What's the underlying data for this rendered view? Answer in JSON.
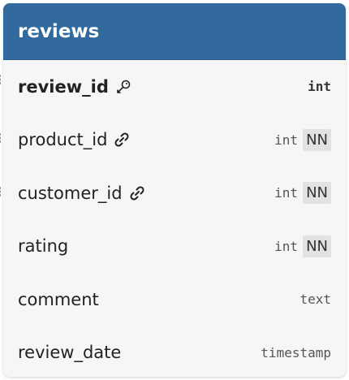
{
  "table": {
    "name": "reviews",
    "columns": [
      {
        "name": "review_id",
        "type": "int",
        "primary_key": true,
        "foreign_key": false,
        "not_null": false,
        "icon": "key-icon"
      },
      {
        "name": "product_id",
        "type": "int",
        "primary_key": false,
        "foreign_key": true,
        "not_null": true,
        "nn_label": "NN",
        "icon": "link-icon"
      },
      {
        "name": "customer_id",
        "type": "int",
        "primary_key": false,
        "foreign_key": true,
        "not_null": true,
        "nn_label": "NN",
        "icon": "link-icon"
      },
      {
        "name": "rating",
        "type": "int",
        "primary_key": false,
        "foreign_key": false,
        "not_null": true,
        "nn_label": "NN"
      },
      {
        "name": "comment",
        "type": "text",
        "primary_key": false,
        "foreign_key": false,
        "not_null": false
      },
      {
        "name": "review_date",
        "type": "timestamp",
        "primary_key": false,
        "foreign_key": false,
        "not_null": false
      }
    ]
  },
  "colors": {
    "header_bg": "#326a9d",
    "body_bg": "#f6f6f6",
    "nn_bg": "#e2e2e2"
  }
}
